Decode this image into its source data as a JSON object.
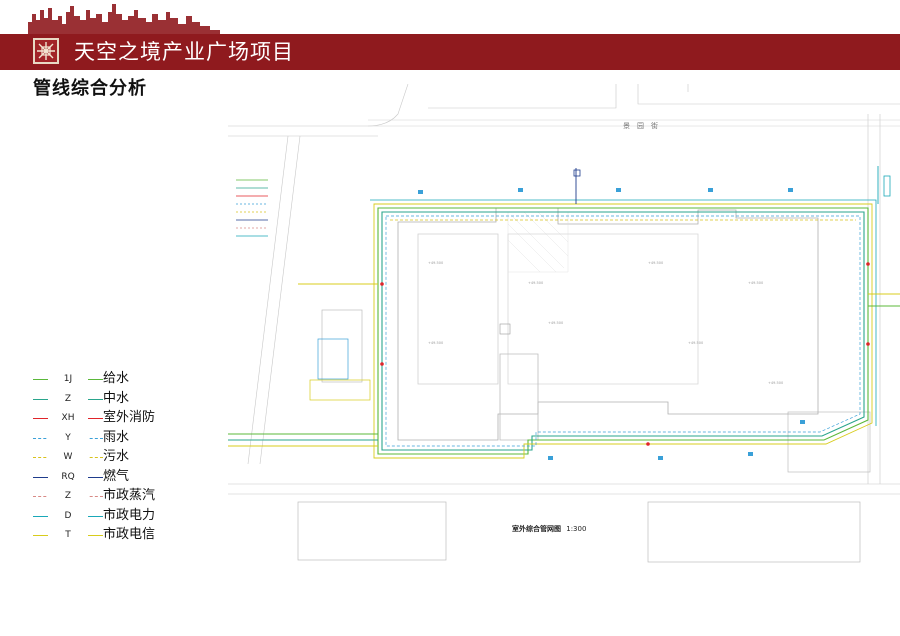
{
  "header": {
    "title": "天空之境产业广场项目",
    "subtitle": "管线综合分析"
  },
  "plan": {
    "caption": "室外综合管网图",
    "scale": "1:300",
    "street_top": "景　园　街"
  },
  "legend": [
    {
      "code": "1J",
      "label": "给水",
      "color": "#5bb83a",
      "style": "solid"
    },
    {
      "code": "Z",
      "label": "中水",
      "color": "#2aa58c",
      "style": "solid"
    },
    {
      "code": "XH",
      "label": "室外消防",
      "color": "#e0242a",
      "style": "solid"
    },
    {
      "code": "Y",
      "label": "雨水",
      "color": "#3aa0d8",
      "style": "dashed"
    },
    {
      "code": "W",
      "label": "污水",
      "color": "#d8c21c",
      "style": "dashed"
    },
    {
      "code": "RQ",
      "label": "燃气",
      "color": "#1f3c8c",
      "style": "solid"
    },
    {
      "code": "Z",
      "label": "市政蒸汽",
      "color": "#d88a86",
      "style": "dashed"
    },
    {
      "code": "D",
      "label": "市政电力",
      "color": "#1aa8b8",
      "style": "solid"
    },
    {
      "code": "T",
      "label": "市政电信",
      "color": "#d8cc1c",
      "style": "solid"
    }
  ]
}
